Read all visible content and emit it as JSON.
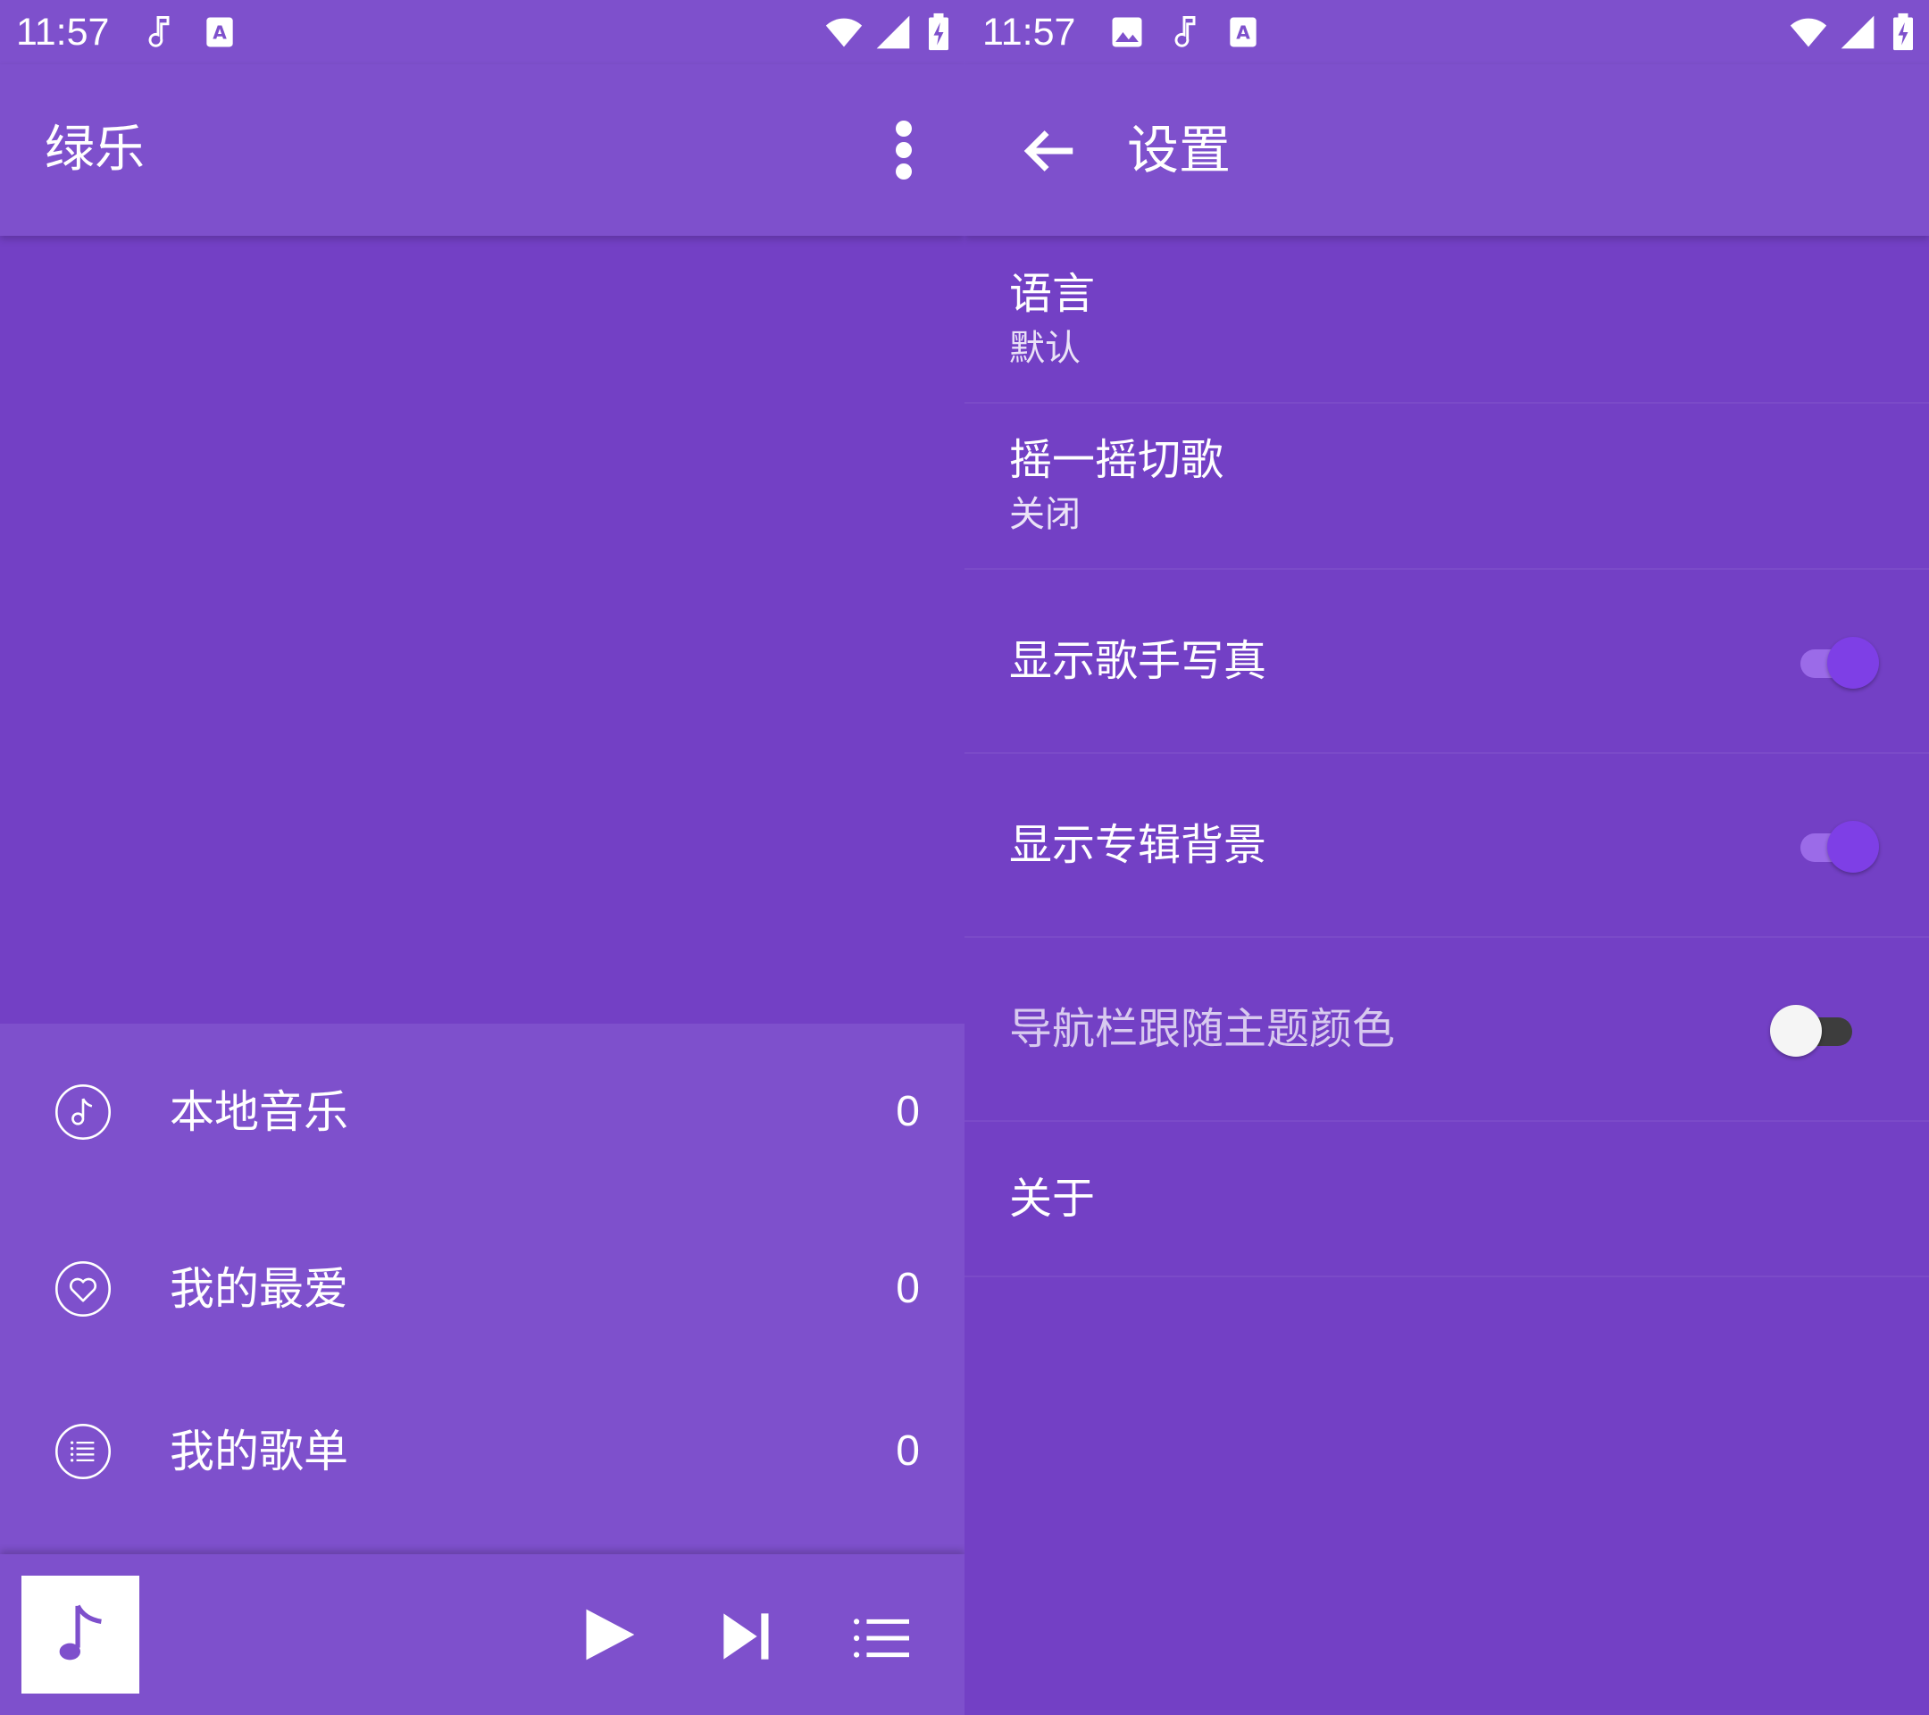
{
  "left": {
    "status": {
      "time": "11:57"
    },
    "appbar": {
      "title": "绿乐",
      "more": "more-vert-icon"
    },
    "menu": [
      {
        "icon": "music-note-circle-icon",
        "label": "本地音乐",
        "count": "0"
      },
      {
        "icon": "heart-circle-icon",
        "label": "我的最爱",
        "count": "0"
      },
      {
        "icon": "playlist-circle-icon",
        "label": "我的歌单",
        "count": "0"
      }
    ],
    "player": {
      "art": "music-note-icon",
      "play": "play-icon",
      "next": "skip-next-icon",
      "queue": "queue-list-icon"
    }
  },
  "right": {
    "status": {
      "time": "11:57"
    },
    "appbar": {
      "title": "设置",
      "back": "arrow-back-icon"
    },
    "settings": [
      {
        "title": "语言",
        "subtitle": "默认"
      },
      {
        "title": "摇一摇切歌",
        "subtitle": "关闭"
      },
      {
        "title": "显示歌手写真",
        "toggle": true
      },
      {
        "title": "显示专辑背景",
        "toggle": true
      },
      {
        "title": "导航栏跟随主题颜色",
        "toggle": false
      },
      {
        "title": "关于"
      }
    ]
  },
  "colors": {
    "primary": "#7e50cc",
    "background": "#7340c5",
    "accent": "#7e3fe6"
  }
}
